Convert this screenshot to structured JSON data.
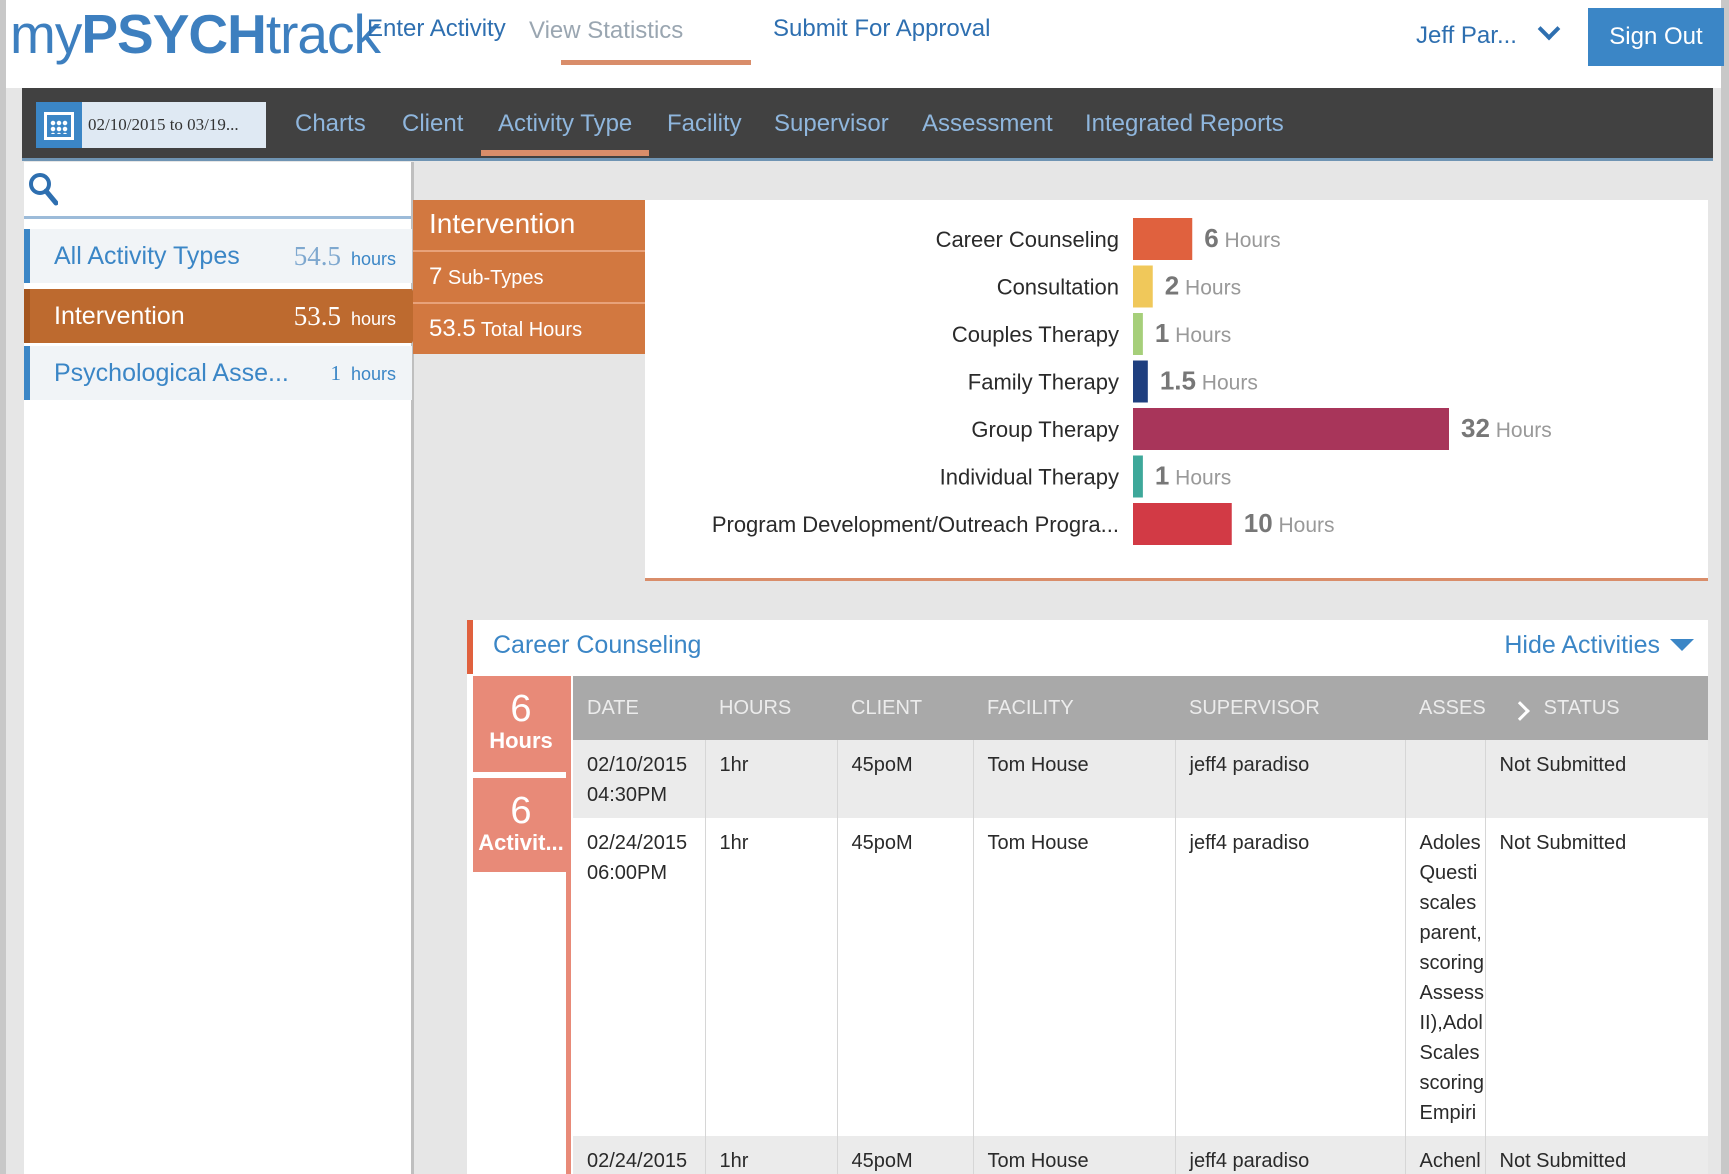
{
  "header": {
    "logo_prefix": "my",
    "logo_bold": "PSYCH",
    "logo_suffix": "track",
    "nav": [
      {
        "label": "Enter Activity"
      },
      {
        "label": "View Statistics"
      },
      {
        "label": "Submit For Approval"
      }
    ],
    "user": "Jeff Par...",
    "sign_out": "Sign Out"
  },
  "subnav": {
    "date_range": "02/10/2015 to 03/19...",
    "tabs": [
      "Charts",
      "Client",
      "Activity Type",
      "Facility",
      "Supervisor",
      "Assessment",
      "Integrated Reports"
    ],
    "active_tab": "Activity Type"
  },
  "sidebar": {
    "items": [
      {
        "label": "All Activity Types",
        "hours": "54.5",
        "unit": "hours"
      },
      {
        "label": "Intervention",
        "hours": "53.5",
        "unit": "hours"
      },
      {
        "label": "Psychological Asse...",
        "hours": "1",
        "unit": "hours"
      }
    ]
  },
  "summary": {
    "title": "Intervention",
    "subtypes_num": "7",
    "subtypes_label": "Sub-Types",
    "total_num": "53.5",
    "total_label": "Total Hours"
  },
  "chart_data": {
    "type": "bar",
    "orientation": "horizontal",
    "unit_label": "Hours",
    "categories": [
      "Career Counseling",
      "Consultation",
      "Couples Therapy",
      "Family Therapy",
      "Group Therapy",
      "Individual Therapy",
      "Program Development/Outreach Progra..."
    ],
    "values": [
      6,
      2,
      1,
      1.5,
      32,
      1,
      10
    ],
    "colors": [
      "#e0613e",
      "#f0c85a",
      "#a6cf7a",
      "#1f3f7f",
      "#a8355a",
      "#3ea89a",
      "#d23a45"
    ],
    "xlim": [
      0,
      32
    ]
  },
  "detail": {
    "title": "Career Counseling",
    "hide_label": "Hide Activities",
    "hours_num": "6",
    "hours_label": "Hours",
    "acts_num": "6",
    "acts_label": "Activit...",
    "columns": [
      "DATE",
      "HOURS",
      "CLIENT",
      "FACILITY",
      "SUPERVISOR",
      "ASSES",
      "STATUS"
    ],
    "rows": [
      {
        "date": "02/10/2015",
        "time": "04:30PM",
        "hours": "1hr",
        "client": "45poM",
        "facility": "Tom House",
        "supervisor": "jeff4 paradiso",
        "assessment": [],
        "status": "Not Submitted"
      },
      {
        "date": "02/24/2015",
        "time": "06:00PM",
        "hours": "1hr",
        "client": "45poM",
        "facility": "Tom House",
        "supervisor": "jeff4 paradiso",
        "assessment": [
          "Adoles",
          "Questi",
          "scales",
          "parent,",
          "scoring",
          "Assess",
          "II),Adol",
          "Scales",
          "scoring",
          "Empiri"
        ],
        "status": "Not Submitted"
      },
      {
        "date": "02/24/2015",
        "time": "",
        "hours": "1hr",
        "client": "45poM",
        "facility": "Tom House",
        "supervisor": "jeff4 paradiso",
        "assessment": [
          "Achenl"
        ],
        "status": "Not Submitted"
      }
    ]
  }
}
